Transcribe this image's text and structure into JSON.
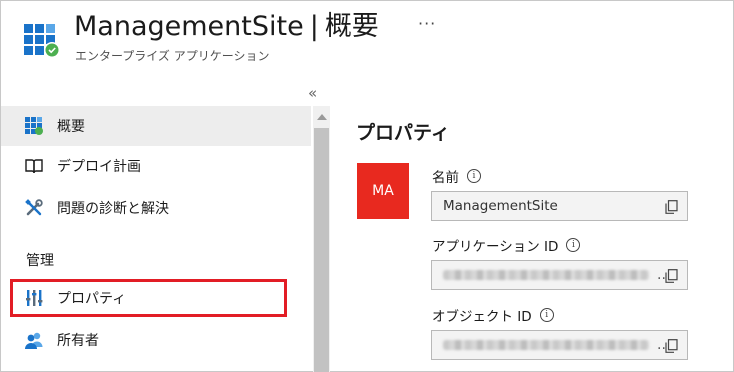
{
  "header": {
    "app_name": "ManagementSite",
    "separator": "|",
    "page": "概要",
    "more": "···",
    "subtitle": "エンタープライズ アプリケーション"
  },
  "sidebar": {
    "collapse_glyph": "«",
    "items": [
      {
        "label": "概要",
        "icon": "grid-app-icon",
        "active": true
      },
      {
        "label": "デプロイ計画",
        "icon": "book-icon"
      },
      {
        "label": "問題の診断と解決",
        "icon": "wrench-screwdriver-icon"
      }
    ],
    "section": "管理",
    "manage_items": [
      {
        "label": "プロパティ",
        "icon": "properties-icon",
        "highlighted": true
      },
      {
        "label": "所有者",
        "icon": "people-icon"
      }
    ]
  },
  "main": {
    "title": "プロパティ",
    "avatar_initials": "MA",
    "avatar_color": "#e8291f",
    "fields": [
      {
        "label": "名前",
        "value": "ManagementSite"
      },
      {
        "label": "アプリケーション ID",
        "value": "",
        "redacted": true,
        "ellipsis": ".."
      },
      {
        "label": "オブジェクト ID",
        "value": "",
        "redacted": true,
        "ellipsis": ".."
      }
    ],
    "info_glyph": "i"
  },
  "colors": {
    "highlight": "#e21d25",
    "accent": "#0078d4"
  }
}
